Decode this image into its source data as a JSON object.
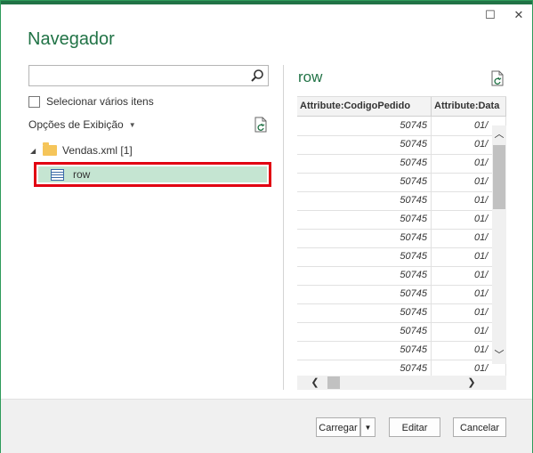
{
  "window": {
    "title": "Navegador",
    "maximize_glyph": "☐",
    "close_glyph": "✕"
  },
  "left": {
    "search": {
      "placeholder": "",
      "value": ""
    },
    "multi_select_label": "Selecionar vários itens",
    "display_options_label": "Opções de Exibição",
    "tree": {
      "folder_label": "Vendas.xml [1]",
      "items": [
        {
          "label": "row",
          "selected": true
        }
      ]
    }
  },
  "preview": {
    "title": "row",
    "columns": [
      "Attribute:CodigoPedido",
      "Attribute:Data"
    ],
    "rows": [
      [
        "50745",
        "01/"
      ],
      [
        "50745",
        "01/"
      ],
      [
        "50745",
        "01/"
      ],
      [
        "50745",
        "01/"
      ],
      [
        "50745",
        "01/"
      ],
      [
        "50745",
        "01/"
      ],
      [
        "50745",
        "01/"
      ],
      [
        "50745",
        "01/"
      ],
      [
        "50745",
        "01/"
      ],
      [
        "50745",
        "01/"
      ],
      [
        "50745",
        "01/"
      ],
      [
        "50745",
        "01/"
      ],
      [
        "50745",
        "01/"
      ],
      [
        "50745",
        "01/"
      ]
    ]
  },
  "footer": {
    "load_label": "Carregar",
    "edit_label": "Editar",
    "cancel_label": "Cancelar"
  },
  "colors": {
    "accent": "#217346",
    "selection_border": "#e10012",
    "selection_fill": "#c5e5d2"
  },
  "icons": [
    "search-icon",
    "refresh-icon",
    "folder-icon",
    "table-icon",
    "dropdown-caret-icon",
    "maximize-icon",
    "close-icon"
  ]
}
